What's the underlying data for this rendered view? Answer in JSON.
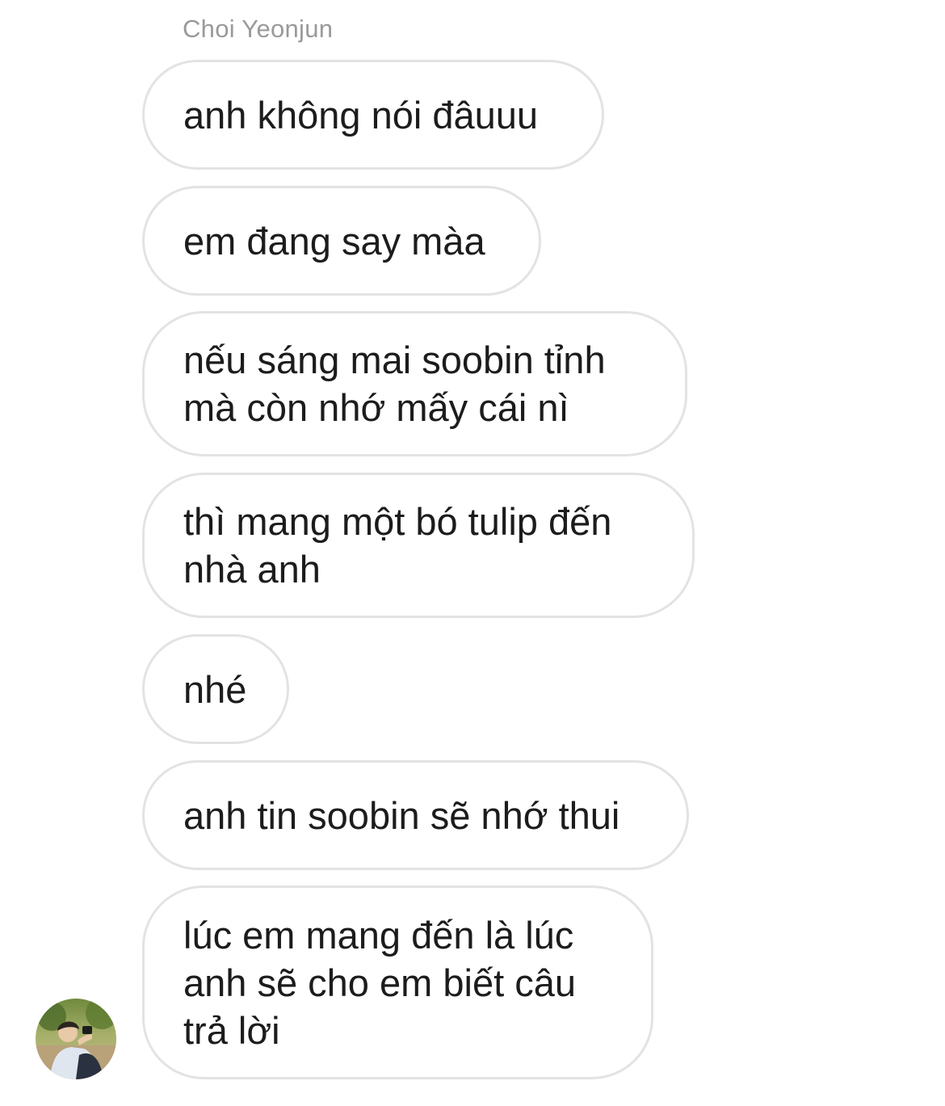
{
  "chat": {
    "sender_name": "Choi Yeonjun",
    "messages": [
      {
        "text": "anh không nói đâuuu"
      },
      {
        "text": "em đang say màa"
      },
      {
        "text": "nếu sáng mai soobin tỉnh\nmà còn nhớ mấy cái nì"
      },
      {
        "text": "thì mang một bó tulip đến\nnhà anh"
      },
      {
        "text": "nhé"
      },
      {
        "text": "anh tin soobin sẽ nhớ thui"
      },
      {
        "text": "lúc em mang đến là lúc\nanh sẽ cho em biết câu\ntrả lời"
      }
    ],
    "avatar_icon": "user-photo-avatar"
  },
  "colors": {
    "bubble_border": "#e3e3e3",
    "text": "#1c1c1c",
    "sender_name": "#9a9a9a",
    "background": "#ffffff"
  }
}
